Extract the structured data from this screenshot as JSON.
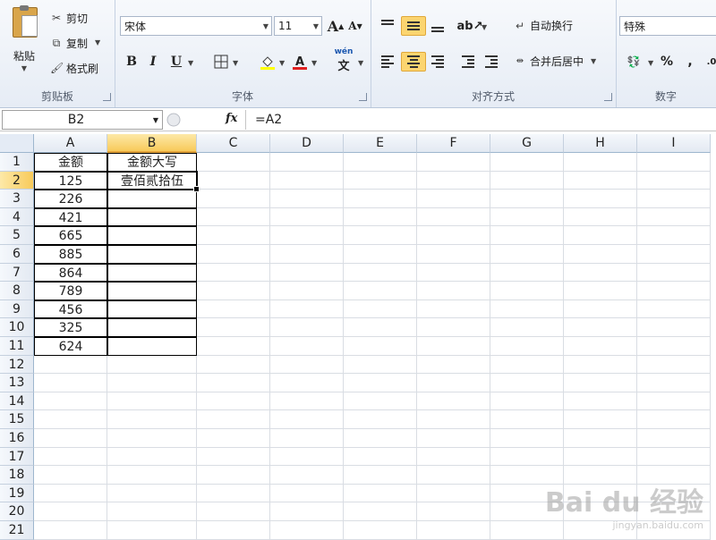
{
  "ribbon": {
    "clipboard": {
      "paste": "粘贴",
      "cut": "剪切",
      "copy": "复制",
      "format_painter": "格式刷",
      "group_label": "剪贴板"
    },
    "font": {
      "font_name": "宋体",
      "font_size": "11",
      "bold": "B",
      "italic": "I",
      "underline": "U",
      "grow": "A",
      "shrink": "A",
      "phonetic": "wén",
      "group_label": "字体"
    },
    "alignment": {
      "wrap_text": "自动换行",
      "merge_center": "合并后居中",
      "group_label": "对齐方式"
    },
    "number": {
      "format": "特殊",
      "percent": "%",
      "comma": ",",
      "group_label": "数字"
    }
  },
  "formula_bar": {
    "name_box": "B2",
    "fx": "fx",
    "formula": "=A2"
  },
  "columns": [
    "A",
    "B",
    "C",
    "D",
    "E",
    "F",
    "G",
    "H",
    "I"
  ],
  "rows": [
    "1",
    "2",
    "3",
    "4",
    "5",
    "6",
    "7",
    "8",
    "9",
    "10",
    "11",
    "12",
    "13",
    "14",
    "15",
    "16",
    "17",
    "18",
    "19",
    "20",
    "21"
  ],
  "cells": {
    "A1": "金额",
    "B1": "金额大写",
    "A2": "125",
    "B2": "壹佰贰拾伍",
    "A3": "226",
    "A4": "421",
    "A5": "665",
    "A6": "885",
    "A7": "864",
    "A8": "789",
    "A9": "456",
    "A10": "325",
    "A11": "624"
  },
  "watermark": {
    "main": "Bai du 经验",
    "sub": "jingyan.baidu.com"
  },
  "colors": {
    "selection": "#f8ca5a",
    "ribbon_bg": "#e6ecf5"
  }
}
